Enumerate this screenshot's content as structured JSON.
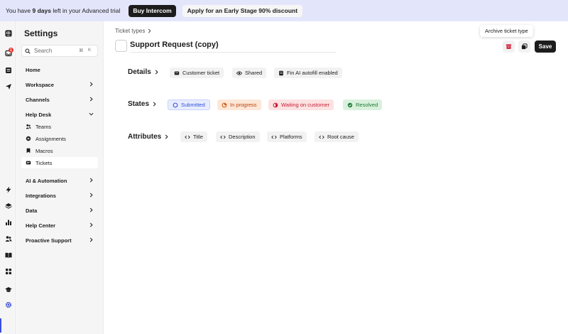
{
  "banner": {
    "prefix": "You have ",
    "days": "9 days",
    "suffix": " left in your Advanced trial",
    "buy_label": "Buy Intercom",
    "discount_label": "Apply for an Early Stage 90% discount"
  },
  "rail": {
    "notification_count": "1",
    "icons": [
      "intercom-logo-icon",
      "inbox-icon",
      "contacts-icon",
      "outbound-icon",
      "lightning-icon",
      "layers-icon",
      "reports-icon",
      "people-icon",
      "book-icon",
      "apps-icon",
      "academy-icon",
      "settings-icon"
    ]
  },
  "sidebar": {
    "title": "Settings",
    "search_placeholder": "Search",
    "search_shortcut_1": "⌘",
    "search_shortcut_2": "K",
    "items": [
      {
        "label": "Home"
      },
      {
        "label": "Workspace"
      },
      {
        "label": "Channels"
      },
      {
        "label": "Help Desk"
      },
      {
        "label": "AI & Automation"
      },
      {
        "label": "Integrations"
      },
      {
        "label": "Data"
      },
      {
        "label": "Help Center"
      },
      {
        "label": "Proactive Support"
      }
    ],
    "help_desk_sub": [
      {
        "label": "Teams"
      },
      {
        "label": "Assignments"
      },
      {
        "label": "Macros"
      },
      {
        "label": "Tickets"
      }
    ]
  },
  "main": {
    "breadcrumb": "Ticket types",
    "ticket_name": "Support Request (copy)",
    "tooltip": "Archive ticket type",
    "save_label": "Save",
    "details_label": "Details",
    "details_chips": [
      "Customer ticket",
      "Shared",
      "Fin AI autofill enabled"
    ],
    "states_label": "States",
    "states_chips": [
      "Submitted",
      "In progress",
      "Waiting on customer",
      "Resolved"
    ],
    "attributes_label": "Attributes",
    "attributes_chips": [
      "Title",
      "Description",
      "Platforms",
      "Root cause"
    ]
  },
  "colors": {
    "banner_bg": "#e3e6fb",
    "accent": "#3a4ee0",
    "submitted": "#3250d8",
    "in_progress": "#b5440c",
    "waiting": "#c4213a",
    "resolved": "#1f7a36"
  }
}
